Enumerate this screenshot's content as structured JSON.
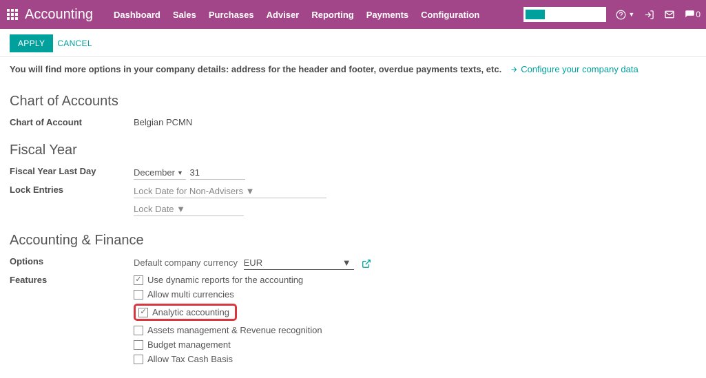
{
  "app": {
    "title": "Accounting",
    "nav": [
      "Dashboard",
      "Sales",
      "Purchases",
      "Adviser",
      "Reporting",
      "Payments",
      "Configuration"
    ],
    "msg_count": "0"
  },
  "buttons": {
    "apply": "APPLY",
    "cancel": "CANCEL"
  },
  "info": {
    "text": "You will find more options in your company details: address for the header and footer, overdue payments texts, etc.",
    "config_link": "Configure your company data"
  },
  "chart": {
    "section": "Chart of Accounts",
    "label": "Chart of Account",
    "value": "Belgian PCMN"
  },
  "fiscal": {
    "section": "Fiscal Year",
    "last_day_label": "Fiscal Year Last Day",
    "month": "December",
    "day": "31",
    "lock_label": "Lock Entries",
    "lock_non_adv": "Lock Date for Non-Advisers",
    "lock_date": "Lock Date"
  },
  "accfin": {
    "section": "Accounting & Finance",
    "options_label": "Options",
    "currency_label": "Default company currency",
    "currency_value": "EUR",
    "features_label": "Features",
    "features": [
      {
        "label": "Use dynamic reports for the accounting",
        "checked": true,
        "highlight": false
      },
      {
        "label": "Allow multi currencies",
        "checked": false,
        "highlight": false
      },
      {
        "label": "Analytic accounting",
        "checked": true,
        "highlight": true
      },
      {
        "label": "Assets management & Revenue recognition",
        "checked": false,
        "highlight": false
      },
      {
        "label": "Budget management",
        "checked": false,
        "highlight": false
      },
      {
        "label": "Allow Tax Cash Basis",
        "checked": false,
        "highlight": false
      }
    ]
  }
}
